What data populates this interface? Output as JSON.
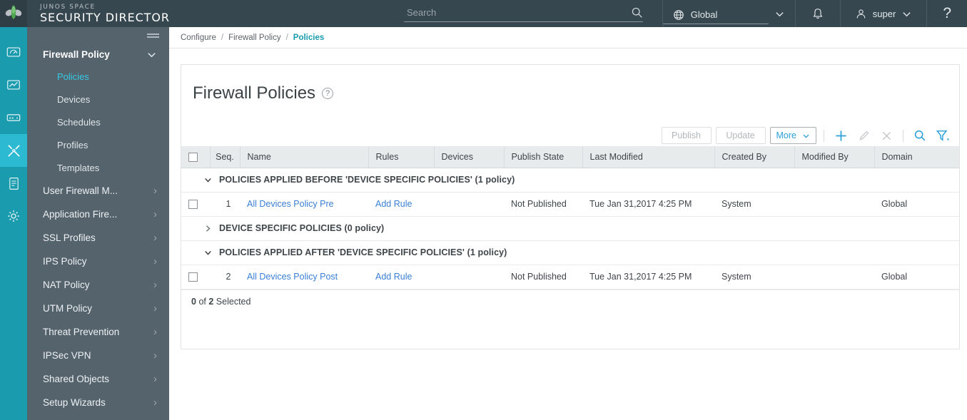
{
  "header": {
    "brand_top": "JUNOS SPACE",
    "brand_main": "SECURITY DIRECTOR",
    "search_placeholder": "Search",
    "search_value": "",
    "domain_selector": "Global",
    "user": "super",
    "help": "?",
    "bg_color": "#37474f"
  },
  "rail": {
    "items": [
      {
        "name": "dashboard",
        "icon": "gauge-icon",
        "active": false
      },
      {
        "name": "monitor",
        "icon": "chart-icon",
        "active": false
      },
      {
        "name": "devices",
        "icon": "card-icon",
        "active": false
      },
      {
        "name": "configure",
        "icon": "tools-icon",
        "active": true
      },
      {
        "name": "reports",
        "icon": "document-icon",
        "active": false
      },
      {
        "name": "administration",
        "icon": "gear-icon",
        "active": false
      }
    ],
    "accent": "#1a9cae",
    "active_color": "#2cb9d2"
  },
  "sidebar": {
    "group_title": "Firewall Policy",
    "sub_items": [
      {
        "label": "Policies",
        "active": true
      },
      {
        "label": "Devices",
        "active": false
      },
      {
        "label": "Schedules",
        "active": false
      },
      {
        "label": "Profiles",
        "active": false
      },
      {
        "label": "Templates",
        "active": false
      }
    ],
    "items": [
      {
        "label": "User Firewall M..."
      },
      {
        "label": "Application Fire..."
      },
      {
        "label": "SSL Profiles"
      },
      {
        "label": "IPS Policy"
      },
      {
        "label": "NAT Policy"
      },
      {
        "label": "UTM Policy"
      },
      {
        "label": "Threat Prevention"
      },
      {
        "label": "IPSec VPN"
      },
      {
        "label": "Shared Objects"
      },
      {
        "label": "Setup Wizards"
      }
    ],
    "active_color": "#36c9e3"
  },
  "breadcrumb": [
    {
      "label": "Configure",
      "current": false
    },
    {
      "label": "Firewall Policy",
      "current": false
    },
    {
      "label": "Policies",
      "current": true
    }
  ],
  "page": {
    "title": "Firewall Policies",
    "help_glyph": "?"
  },
  "toolbar": {
    "publish_label": "Publish",
    "update_label": "Update",
    "more_label": "More",
    "icons": [
      "add-icon",
      "edit-icon",
      "delete-icon",
      "search-icon",
      "filter-icon"
    ]
  },
  "table": {
    "columns": [
      "Seq.",
      "Name",
      "Rules",
      "Devices",
      "Publish State",
      "Last Modified",
      "Created By",
      "Modified By",
      "Domain"
    ],
    "rows": [
      {
        "kind": "group",
        "expanded": true,
        "label": "POLICIES APPLIED BEFORE 'DEVICE SPECIFIC POLICIES' (1 policy)"
      },
      {
        "kind": "data",
        "seq": "1",
        "name": "All Devices Policy Pre",
        "rules": "Add Rule",
        "devices": "",
        "publish_state": "Not Published",
        "last_modified": "Tue Jan 31,2017 4:25 PM",
        "created_by": "System",
        "modified_by": "",
        "domain": "Global"
      },
      {
        "kind": "group",
        "expanded": false,
        "label": "DEVICE SPECIFIC POLICIES (0 policy)"
      },
      {
        "kind": "group",
        "expanded": true,
        "label": "POLICIES APPLIED AFTER 'DEVICE SPECIFIC POLICIES' (1 policy)"
      },
      {
        "kind": "data",
        "seq": "2",
        "name": "All Devices Policy Post",
        "rules": "Add Rule",
        "devices": "",
        "publish_state": "Not Published",
        "last_modified": "Tue Jan 31,2017 4:25 PM",
        "created_by": "System",
        "modified_by": "",
        "domain": "Global"
      }
    ],
    "selection_prefix": "0",
    "selection_middle": "of",
    "selection_count": "2",
    "selection_suffix": "Selected"
  }
}
